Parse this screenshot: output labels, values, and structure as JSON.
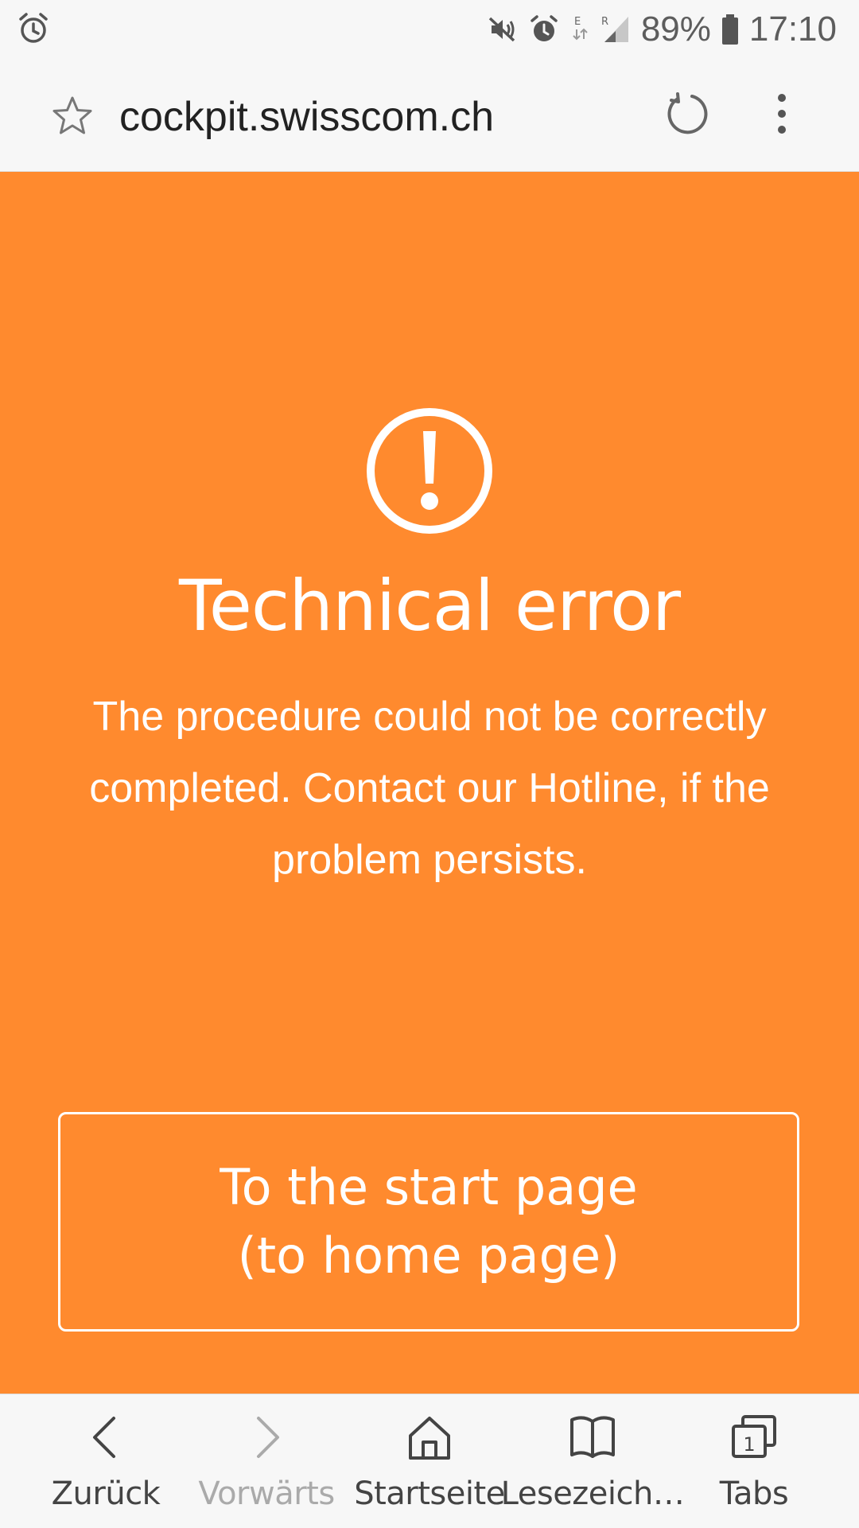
{
  "status_bar": {
    "left_icon": "alarm-clock-icon",
    "right_icons": [
      "mute-icon",
      "alarm-icon",
      "data-e-icon",
      "signal-r-icon"
    ],
    "battery_percent": "89%",
    "time": "17:10"
  },
  "address_bar": {
    "star_icon": "star-outline-icon",
    "url": "cockpit.swisscom.ch",
    "reload_icon": "reload-icon",
    "menu_icon": "more-vertical-icon"
  },
  "main": {
    "background_color": "#ff8a2e",
    "icon": "exclamation-circle-icon",
    "title": "Technical error",
    "message": "The procedure could not be correctly completed. Contact our Hotline, if the problem persists.",
    "button_label": "To the start page (to home page)"
  },
  "bottom_nav": {
    "items": [
      {
        "label": "Zurück",
        "icon": "back-chevron-icon",
        "enabled": true
      },
      {
        "label": "Vorwärts",
        "icon": "forward-chevron-icon",
        "enabled": false
      },
      {
        "label": "Startseite",
        "icon": "home-icon",
        "enabled": true
      },
      {
        "label": "Lesezeich…",
        "icon": "bookmark-book-icon",
        "enabled": true
      },
      {
        "label": "Tabs",
        "icon": "tabs-icon",
        "enabled": true,
        "tab_count": "1"
      }
    ]
  }
}
